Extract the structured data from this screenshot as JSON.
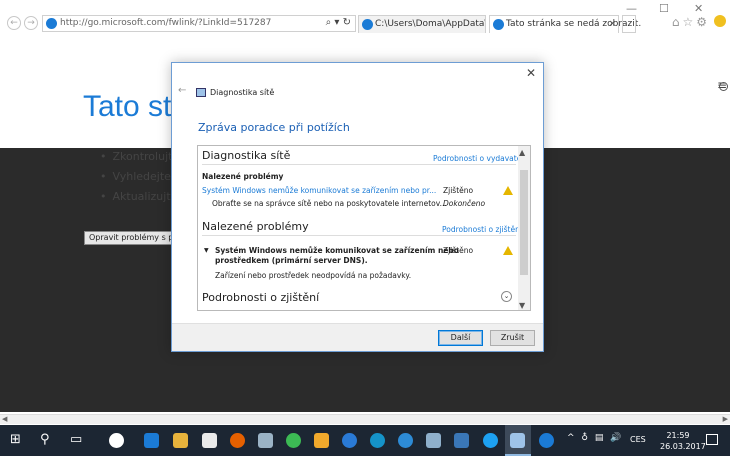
{
  "browser": {
    "url": "http://go.microsoft.com/fwlink/?LinkId=517287",
    "address_tools": "⌕ ▾ ↻",
    "tabs": [
      {
        "label": "C:\\Users\\Doma\\AppData\\Local..."
      },
      {
        "label": "Tato stránka se nedá zobrazit.",
        "close": "×"
      }
    ],
    "window_controls": {
      "minimize": "—",
      "maximize": "☐",
      "close": "✕"
    },
    "nav": {
      "back": "←",
      "forward": "→"
    },
    "hamburger": "≡",
    "right_icons": "⌂☆⚙"
  },
  "page": {
    "title": "Tato stránka se nedá zobrazit",
    "bullets": [
      "Zkontrolujte, je",
      "Vyhledejte strá",
      "Aktualizujte str"
    ],
    "fix_button": "Opravit problémy s připojením"
  },
  "dialog": {
    "back": "←",
    "close": "✕",
    "window_title": "Diagnostika sítě",
    "heading": "Zpráva poradce při potížích",
    "section1": {
      "title": "Diagnostika sítě",
      "link": "Podrobnosti o vydavateli",
      "subtitle": "Nalezené problémy",
      "row1_text": "Systém Windows nemůže komunikovat se zařízením nebo pr...",
      "row1_status": "Zjištěno",
      "row2_text": "Obraťte se na správce sítě nebo na poskytovatele internetov...",
      "row2_status": "Dokončeno"
    },
    "section2": {
      "title": "Nalezené problémy",
      "link": "Podrobnosti o zjištění",
      "caret": "▼",
      "issue_line1": "Systém Windows nemůže komunikovat se zařízením nebo",
      "issue_line2": "prostředkem (primární server DNS).",
      "issue_status": "Zjištěno",
      "issue_desc": "Zařízení nebo prostředek neodpovídá na požadavky."
    },
    "section3": {
      "title": "Podrobnosti o zjištění",
      "expand": "⌄"
    },
    "buttons": {
      "next": "Další",
      "cancel": "Zrušit"
    },
    "scroll": {
      "up": "▲",
      "down": "▼"
    }
  },
  "scrollbar": {
    "left": "◀",
    "right": "▶"
  },
  "taskbar": {
    "start": "⊞",
    "search": "⚲",
    "taskview": "▭",
    "tray_icons": "^ ♁ ▤ 🔊",
    "language": "CES",
    "time": "21:59",
    "date": "26.03.2017"
  },
  "colors": {
    "accent": "#1b7bd6",
    "taskbar": "#1c2633",
    "warning": "#e5b600"
  }
}
